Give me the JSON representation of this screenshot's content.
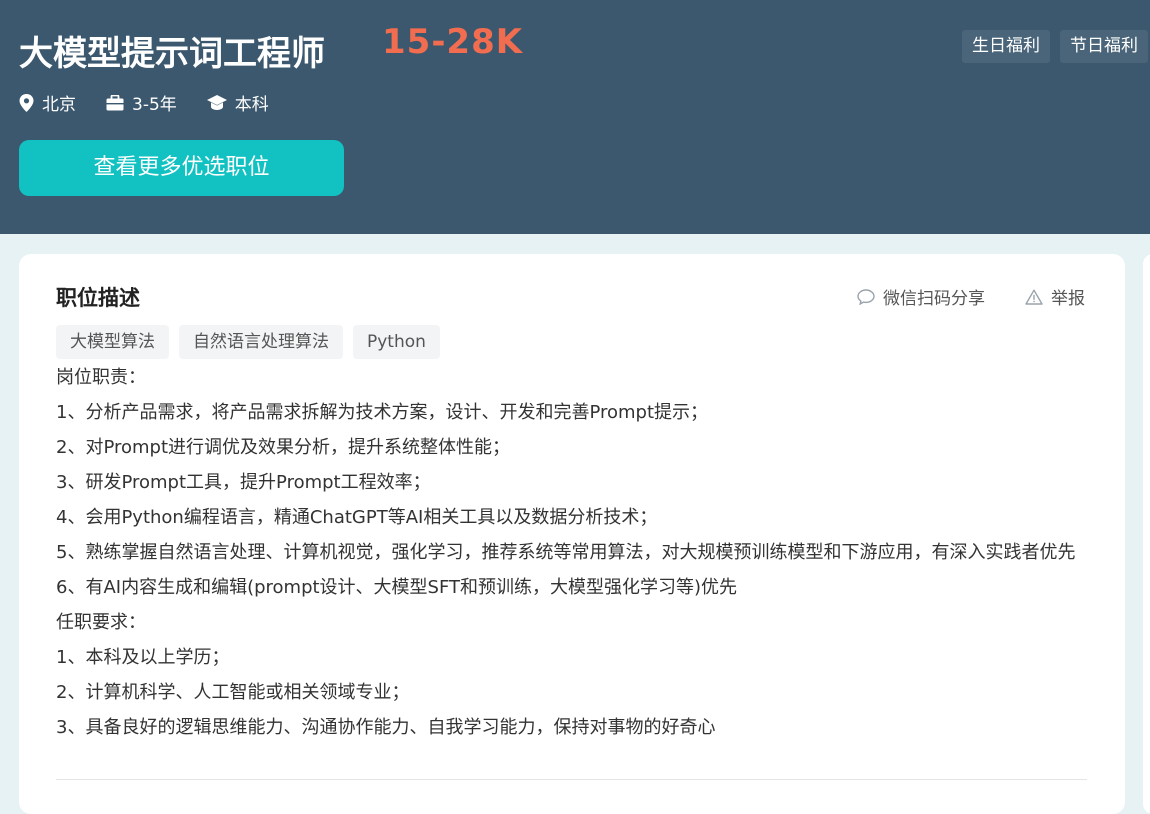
{
  "header": {
    "title": "大模型提示词工程师",
    "salary": "15-28K",
    "benefits": [
      "生日福利",
      "节日福利"
    ],
    "meta": {
      "location": "北京",
      "experience": "3-5年",
      "education": "本科"
    },
    "cta_label": "查看更多优选职位"
  },
  "card": {
    "section_title": "职位描述",
    "share_label": "微信扫码分享",
    "report_label": "举报",
    "tags": [
      "大模型算法",
      "自然语言处理算法",
      "Python"
    ],
    "description": [
      "岗位职责：",
      "1、分析产品需求，将产品需求拆解为技术方案，设计、开发和完善Prompt提示；",
      "2、对Prompt进行调优及效果分析，提升系统整体性能；",
      "3、研发Prompt工具，提升Prompt工程效率；",
      "4、会用Python编程语言，精通ChatGPT等AI相关工具以及数据分析技术；",
      "5、熟练掌握自然语言处理、计算机视觉，强化学习，推荐系统等常用算法，对大规模预训练模型和下游应用，有深入实践者优先",
      "6、有AI内容生成和编辑(prompt设计、大模型SFT和预训练，大模型强化学习等)优先",
      "任职要求：",
      "1、本科及以上学历；",
      "2、计算机科学、人工智能或相关领域专业；",
      "3、具备良好的逻辑思维能力、沟通协作能力、自我学习能力，保持对事物的好奇心"
    ]
  },
  "icons": {
    "location": "location-pin-icon",
    "experience": "briefcase-icon",
    "education": "graduation-cap-icon",
    "share": "chat-bubble-icon",
    "report": "warning-triangle-icon"
  },
  "colors": {
    "header_bg": "#3b586e",
    "salary": "#f26d4f",
    "cta_bg": "#12c1c1",
    "page_bg": "#e6f2f4"
  }
}
